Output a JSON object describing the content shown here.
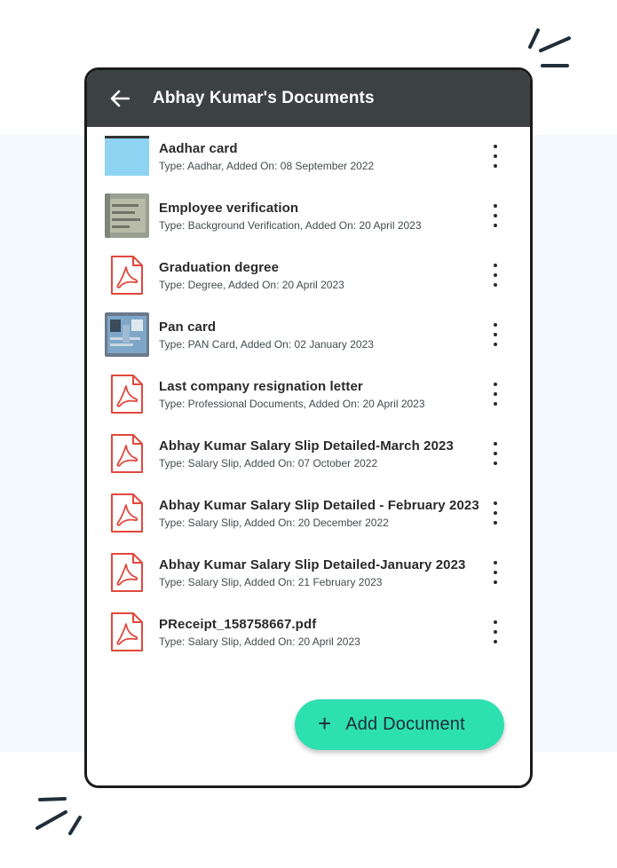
{
  "header": {
    "title": "Abhay Kumar's Documents",
    "back_icon": "arrow-left-icon",
    "bar_color": "#3c4142"
  },
  "documents": [
    {
      "title": "Aadhar card",
      "meta": "Type: Aadhar, Added On: 08 September 2022",
      "thumb": "photo-aadhar"
    },
    {
      "title": "Employee verification",
      "meta": "Type: Background Verification, Added On: 20 April 2023",
      "thumb": "photo-scan"
    },
    {
      "title": "Graduation degree",
      "meta": "Type: Degree, Added On: 20 April 2023",
      "thumb": "pdf-icon"
    },
    {
      "title": "Pan card",
      "meta": "Type: PAN Card, Added On: 02 January 2023",
      "thumb": "photo-pan"
    },
    {
      "title": "Last company resignation letter",
      "meta": "Type: Professional Documents, Added On: 20 April 2023",
      "thumb": "pdf-icon"
    },
    {
      "title": "Abhay Kumar Salary Slip Detailed-March 2023",
      "meta": "Type: Salary Slip, Added On: 07 October 2022",
      "thumb": "pdf-icon"
    },
    {
      "title": "Abhay Kumar Salary Slip Detailed - February 2023",
      "meta": "Type: Salary Slip, Added On: 20 December 2022",
      "thumb": "pdf-icon"
    },
    {
      "title": "Abhay Kumar Salary Slip Detailed-January 2023",
      "meta": "Type: Salary Slip, Added On: 21 February 2023",
      "thumb": "pdf-icon"
    },
    {
      "title": "PReceipt_158758667.pdf",
      "meta": "Type: Salary Slip, Added On: 20 April 2023",
      "thumb": "pdf-icon"
    }
  ],
  "fab": {
    "label": "Add Document",
    "icon": "plus-icon",
    "color": "#2de0b0"
  },
  "colors": {
    "pdf_red": "#e0483d",
    "background_band": "#f3f9fc"
  }
}
